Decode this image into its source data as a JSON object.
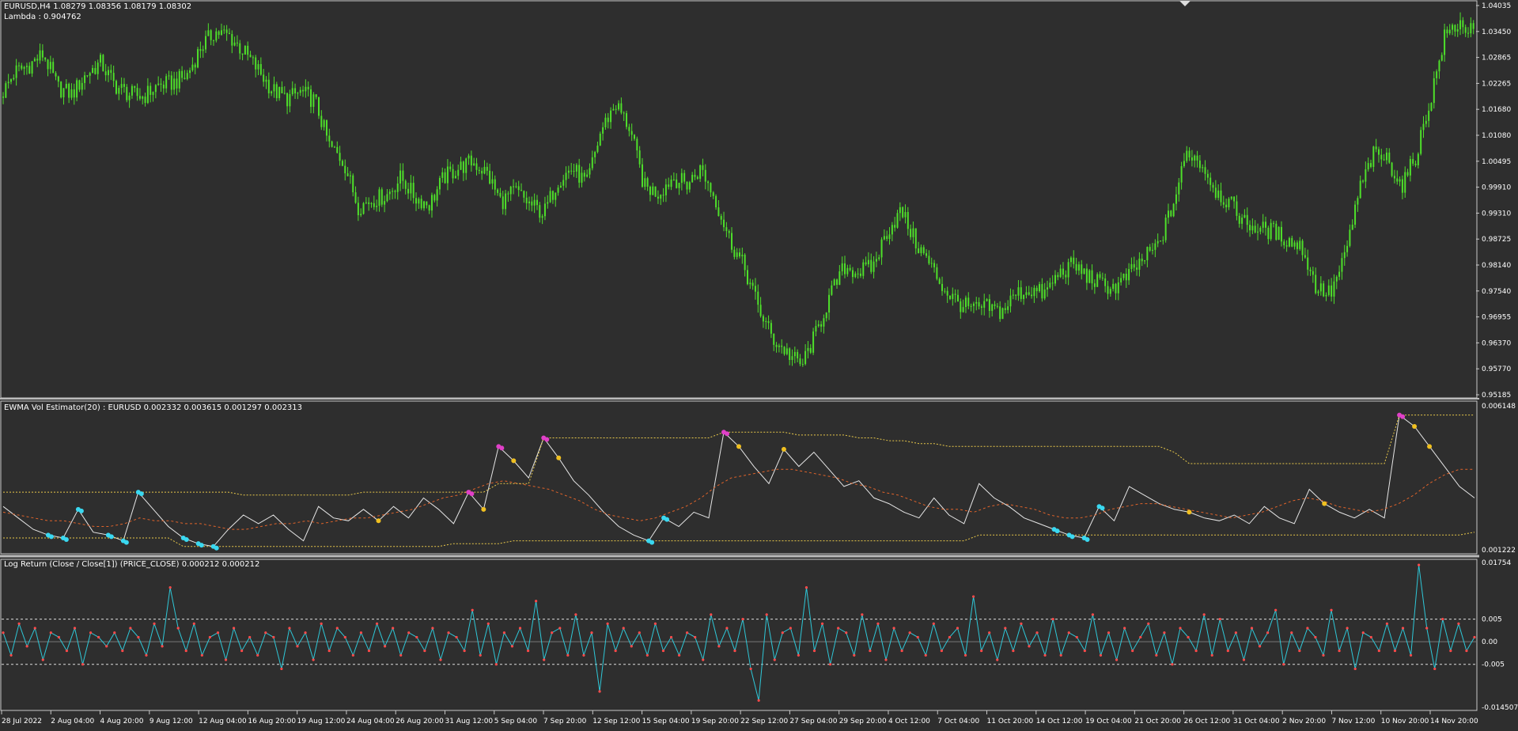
{
  "colors": {
    "background": "#2e2e2e",
    "frame": "#c8c8c8",
    "text": "#ffffff",
    "candle": "#4ee02a",
    "vol_line": "#e6e6e6",
    "vol_mean": "#e0632a",
    "band": "#e8c84a",
    "dot_low": "#3ad8f0",
    "dot_high": "#e040c8",
    "dot_mid": "#f0c020",
    "ret_line": "#2ec8d8",
    "ret_dot": "#ff4a4a",
    "ret_level": "#dddddd"
  },
  "price_panel": {
    "header": "EURUSD,H4  1.08279 1.08356 1.08179 1.08302",
    "subheader": "Lambda : 0.904762",
    "y_ticks": [
      "1.04035",
      "1.03450",
      "1.02865",
      "1.02265",
      "1.01680",
      "1.01080",
      "1.00495",
      "0.99910",
      "0.99310",
      "0.98725",
      "0.98140",
      "0.97540",
      "0.96955",
      "0.96370",
      "0.95770",
      "0.95185"
    ]
  },
  "vol_panel": {
    "header": "EWMA Vol Estimator(20) : EURUSD 0.002332 0.003615 0.001297 0.002313",
    "y_ticks": [
      "0.006148",
      "0.001222"
    ]
  },
  "ret_panel": {
    "header": "Log Return (Close / Close[1]) (PRICE_CLOSE) 0.000212 0.000212",
    "y_ticks": [
      "0.01754",
      "0.005",
      "0.00",
      "-0.005",
      "-0.014507"
    ]
  },
  "x_ticks": [
    "28 Jul 2022",
    "2 Aug 04:00",
    "4 Aug 20:00",
    "9 Aug 12:00",
    "12 Aug 04:00",
    "16 Aug 20:00",
    "19 Aug 12:00",
    "24 Aug 04:00",
    "26 Aug 20:00",
    "31 Aug 12:00",
    "5 Sep 04:00",
    "7 Sep 20:00",
    "12 Sep 12:00",
    "15 Sep 04:00",
    "19 Sep 20:00",
    "22 Sep 12:00",
    "27 Sep 04:00",
    "29 Sep 20:00",
    "4 Oct 12:00",
    "7 Oct 04:00",
    "11 Oct 20:00",
    "14 Oct 12:00",
    "19 Oct 04:00",
    "21 Oct 20:00",
    "26 Oct 12:00",
    "31 Oct 04:00",
    "2 Nov 20:00",
    "7 Nov 12:00",
    "10 Nov 20:00",
    "14 Nov 20:00"
  ],
  "chart_data": [
    {
      "type": "candlestick",
      "title": "EURUSD,H4",
      "ylim": [
        0.95185,
        1.04035
      ],
      "x_tick_labels": [
        "28 Jul 2022",
        "2 Aug 04:00",
        "4 Aug 20:00",
        "9 Aug 12:00",
        "12 Aug 04:00",
        "16 Aug 20:00",
        "19 Aug 12:00",
        "24 Aug 04:00",
        "26 Aug 20:00",
        "31 Aug 12:00",
        "5 Sep 04:00",
        "7 Sep 20:00",
        "12 Sep 12:00",
        "15 Sep 04:00",
        "19 Sep 20:00",
        "22 Sep 12:00",
        "27 Sep 04:00",
        "29 Sep 20:00",
        "4 Oct 12:00",
        "7 Oct 04:00",
        "11 Oct 20:00",
        "14 Oct 12:00",
        "19 Oct 04:00",
        "21 Oct 20:00",
        "26 Oct 12:00",
        "31 Oct 04:00",
        "2 Nov 20:00",
        "7 Nov 12:00",
        "10 Nov 20:00",
        "14 Nov 20:00"
      ],
      "close_path": [
        1.019,
        1.0245,
        1.026,
        1.0285,
        1.021,
        1.0195,
        1.024,
        1.0265,
        1.0215,
        1.0195,
        1.019,
        1.0215,
        1.022,
        1.0235,
        1.03,
        1.0335,
        1.0325,
        1.029,
        1.025,
        1.0205,
        1.0185,
        1.02,
        1.018,
        1.008,
        1.0045,
        0.9945,
        0.996,
        0.997,
        1.001,
        0.9965,
        0.995,
        1.001,
        1.003,
        1.0045,
        1.002,
        0.9955,
        0.998,
        0.995,
        0.993,
        1.0005,
        1.003,
        0.9995,
        1.0115,
        1.0175,
        1.012,
        0.999,
        0.9975,
        1.001,
        0.9995,
        1.003,
        0.996,
        0.987,
        0.981,
        0.972,
        0.965,
        0.962,
        0.959,
        0.966,
        0.9745,
        0.981,
        0.98,
        0.981,
        0.989,
        0.9935,
        0.9865,
        0.9815,
        0.976,
        0.973,
        0.9715,
        0.972,
        0.971,
        0.975,
        0.976,
        0.975,
        0.9795,
        0.9815,
        0.979,
        0.977,
        0.9765,
        0.9795,
        0.983,
        0.986,
        0.995,
        1.007,
        1.004,
        0.998,
        0.995,
        0.991,
        0.9895,
        0.989,
        0.987,
        0.9855,
        0.9765,
        0.975,
        0.983,
        0.998,
        1.006,
        1.005,
        0.999,
        1.006,
        1.0185,
        1.0325,
        1.0355,
        1.033
      ],
      "last": {
        "open": 1.08279,
        "high": 1.08356,
        "low": 1.08179,
        "close": 1.08302
      }
    },
    {
      "type": "line",
      "title": "EWMA Vol Estimator(20) : EURUSD",
      "ylim": [
        0.001222,
        0.006148
      ],
      "series": [
        {
          "values": [
            0.0026,
            0.0022,
            0.0018,
            0.0016,
            0.0015,
            0.0025,
            0.0017,
            0.0016,
            0.0014,
            0.0031,
            0.0025,
            0.0019,
            0.0015,
            0.0013,
            0.0012,
            0.0018,
            0.0023,
            0.002,
            0.0023,
            0.0018,
            0.0014,
            0.0026,
            0.0022,
            0.0021,
            0.0025,
            0.0021,
            0.0026,
            0.0022,
            0.0029,
            0.0025,
            0.002,
            0.0031,
            0.0025,
            0.0047,
            0.0042,
            0.0036,
            0.005,
            0.0043,
            0.0035,
            0.003,
            0.0024,
            0.0019,
            0.0016,
            0.0014,
            0.0022,
            0.0019,
            0.0024,
            0.0022,
            0.0052,
            0.0047,
            0.004,
            0.0034,
            0.0046,
            0.004,
            0.0045,
            0.0039,
            0.0033,
            0.0035,
            0.0029,
            0.0027,
            0.0024,
            0.0022,
            0.0029,
            0.0023,
            0.002,
            0.0034,
            0.0029,
            0.0026,
            0.0022,
            0.002,
            0.0018,
            0.0016,
            0.0015,
            0.0026,
            0.0021,
            0.0033,
            0.003,
            0.0027,
            0.0025,
            0.0024,
            0.0022,
            0.0021,
            0.0023,
            0.002,
            0.0026,
            0.0022,
            0.002,
            0.0032,
            0.0027,
            0.0024,
            0.0022,
            0.0025,
            0.0022,
            0.0058,
            0.0054,
            0.0047,
            0.004,
            0.0033,
            0.0029
          ]
        },
        {
          "values": [
            0.0024,
            0.0023,
            0.0022,
            0.0021,
            0.0021,
            0.002,
            0.0019,
            0.0019,
            0.002,
            0.0022,
            0.0021,
            0.0021,
            0.002,
            0.002,
            0.0019,
            0.0018,
            0.0018,
            0.0019,
            0.002,
            0.002,
            0.0021,
            0.002,
            0.0021,
            0.0022,
            0.0022,
            0.0023,
            0.0024,
            0.0025,
            0.0027,
            0.0029,
            0.003,
            0.0032,
            0.0034,
            0.0035,
            0.0034,
            0.0033,
            0.0032,
            0.003,
            0.0028,
            0.0025,
            0.0023,
            0.0022,
            0.0021,
            0.0022,
            0.0024,
            0.0026,
            0.0029,
            0.0033,
            0.0036,
            0.0037,
            0.0038,
            0.0039,
            0.0039,
            0.0038,
            0.0037,
            0.0036,
            0.0034,
            0.0033,
            0.0031,
            0.003,
            0.0028,
            0.0026,
            0.0025,
            0.0025,
            0.0024,
            0.0026,
            0.0027,
            0.0026,
            0.0025,
            0.0023,
            0.0022,
            0.0022,
            0.0023,
            0.0025,
            0.0026,
            0.0027,
            0.0027,
            0.0026,
            0.0025,
            0.0024,
            0.0023,
            0.0022,
            0.0023,
            0.0024,
            0.0026,
            0.0028,
            0.0029,
            0.0028,
            0.0026,
            0.0025,
            0.0024,
            0.0025,
            0.0027,
            0.003,
            0.0034,
            0.0037,
            0.0039,
            0.0039
          ]
        },
        {
          "values": [
            0.0031,
            0.0031,
            0.0031,
            0.0031,
            0.0031,
            0.0031,
            0.0031,
            0.0031,
            0.0031,
            0.0031,
            0.0031,
            0.0031,
            0.0031,
            0.0031,
            0.0031,
            0.0031,
            0.003,
            0.003,
            0.003,
            0.003,
            0.003,
            0.003,
            0.003,
            0.003,
            0.0031,
            0.0031,
            0.0031,
            0.0031,
            0.0031,
            0.0031,
            0.0031,
            0.0031,
            0.0031,
            0.0034,
            0.0034,
            0.0034,
            0.005,
            0.005,
            0.005,
            0.005,
            0.005,
            0.005,
            0.005,
            0.005,
            0.005,
            0.005,
            0.005,
            0.005,
            0.0052,
            0.0052,
            0.0052,
            0.0052,
            0.0052,
            0.0051,
            0.0051,
            0.0051,
            0.0051,
            0.005,
            0.005,
            0.0049,
            0.0049,
            0.0048,
            0.0048,
            0.0047,
            0.0047,
            0.0047,
            0.0047,
            0.0047,
            0.0047,
            0.0047,
            0.0047,
            0.0047,
            0.0047,
            0.0047,
            0.0047,
            0.0047,
            0.0047,
            0.0047,
            0.0045,
            0.0041,
            0.0041,
            0.0041,
            0.0041,
            0.0041,
            0.0041,
            0.0041,
            0.0041,
            0.0041,
            0.0041,
            0.0041,
            0.0041,
            0.0041,
            0.0041,
            0.0058,
            0.0058,
            0.0058,
            0.0058,
            0.0058,
            0.0058
          ]
        },
        {
          "values": [
            0.0015,
            0.0015,
            0.0015,
            0.0015,
            0.0015,
            0.0015,
            0.0015,
            0.0015,
            0.0015,
            0.0015,
            0.0015,
            0.0015,
            0.0012,
            0.0012,
            0.0012,
            0.0012,
            0.0012,
            0.0012,
            0.0012,
            0.0012,
            0.0012,
            0.0012,
            0.0012,
            0.0012,
            0.0012,
            0.0012,
            0.0012,
            0.0012,
            0.0012,
            0.0012,
            0.0013,
            0.0013,
            0.0013,
            0.0013,
            0.0014,
            0.0014,
            0.0014,
            0.0014,
            0.0014,
            0.0014,
            0.0014,
            0.0014,
            0.0014,
            0.0014,
            0.0014,
            0.0014,
            0.0014,
            0.0014,
            0.0014,
            0.0014,
            0.0014,
            0.0014,
            0.0014,
            0.0014,
            0.0014,
            0.0014,
            0.0014,
            0.0014,
            0.0014,
            0.0014,
            0.0014,
            0.0014,
            0.0014,
            0.0014,
            0.0014,
            0.0016,
            0.0016,
            0.0016,
            0.0016,
            0.0016,
            0.0016,
            0.0016,
            0.0016,
            0.0016,
            0.0016,
            0.0016,
            0.0016,
            0.0016,
            0.0016,
            0.0016,
            0.0016,
            0.0016,
            0.0016,
            0.0016,
            0.0016,
            0.0016,
            0.0016,
            0.0016,
            0.0016,
            0.0016,
            0.0016,
            0.0016,
            0.0016,
            0.0016,
            0.0016,
            0.0016,
            0.0016,
            0.0016,
            0.0017
          ]
        }
      ],
      "markers": {
        "low_cyan_idx": [
          3,
          4,
          5,
          7,
          8,
          9,
          12,
          13,
          14,
          43,
          44,
          70,
          71,
          72,
          73
        ],
        "high_magenta_idx": [
          31,
          33,
          36,
          48,
          93
        ],
        "mid_yellow_idx": [
          25,
          32,
          34,
          37,
          49,
          52,
          79,
          88,
          94,
          95
        ]
      }
    },
    {
      "type": "line",
      "title": "Log Return (Close / Close[1]) (PRICE_CLOSE)",
      "ylim": [
        -0.014507,
        0.01754
      ],
      "levels": [
        0.005,
        0.0,
        -0.005
      ],
      "values": [
        0.002,
        -0.003,
        0.004,
        -0.001,
        0.003,
        -0.004,
        0.002,
        0.001,
        -0.002,
        0.003,
        -0.005,
        0.002,
        0.001,
        -0.001,
        0.002,
        -0.002,
        0.003,
        0.001,
        -0.003,
        0.004,
        -0.001,
        0.012,
        0.003,
        -0.002,
        0.004,
        -0.003,
        0.001,
        0.002,
        -0.004,
        0.003,
        -0.002,
        0.001,
        -0.003,
        0.002,
        0.001,
        -0.006,
        0.003,
        -0.001,
        0.002,
        -0.004,
        0.004,
        -0.002,
        0.003,
        0.001,
        -0.003,
        0.002,
        -0.002,
        0.004,
        -0.001,
        0.003,
        -0.003,
        0.002,
        0.001,
        -0.002,
        0.003,
        -0.004,
        0.002,
        0.001,
        -0.002,
        0.007,
        -0.003,
        0.004,
        -0.005,
        0.002,
        -0.001,
        0.003,
        -0.002,
        0.009,
        -0.004,
        0.002,
        0.003,
        -0.003,
        0.006,
        -0.003,
        0.002,
        -0.011,
        0.004,
        -0.002,
        0.003,
        -0.001,
        0.002,
        -0.003,
        0.004,
        -0.002,
        0.001,
        -0.003,
        0.002,
        0.001,
        -0.004,
        0.006,
        -0.001,
        0.003,
        -0.002,
        0.005,
        -0.006,
        -0.013,
        0.006,
        -0.004,
        0.002,
        0.003,
        -0.003,
        0.012,
        -0.002,
        0.004,
        -0.005,
        0.003,
        0.002,
        -0.003,
        0.006,
        -0.002,
        0.004,
        -0.004,
        0.003,
        -0.002,
        0.002,
        0.001,
        -0.003,
        0.004,
        -0.002,
        0.001,
        0.003,
        -0.003,
        0.01,
        -0.002,
        0.002,
        -0.004,
        0.003,
        -0.002,
        0.004,
        -0.001,
        0.002,
        -0.003,
        0.005,
        -0.003,
        0.002,
        0.001,
        -0.002,
        0.006,
        -0.003,
        0.002,
        -0.004,
        0.003,
        -0.002,
        0.001,
        0.004,
        -0.003,
        0.002,
        -0.005,
        0.003,
        0.001,
        -0.002,
        0.006,
        -0.003,
        0.005,
        -0.002,
        0.002,
        -0.004,
        0.003,
        -0.001,
        0.002,
        0.007,
        -0.005,
        0.002,
        -0.002,
        0.003,
        0.001,
        -0.003,
        0.007,
        -0.002,
        0.003,
        -0.006,
        0.002,
        0.001,
        -0.002,
        0.004,
        -0.002,
        0.003,
        -0.003,
        0.017,
        0.003,
        -0.006,
        0.005,
        -0.002,
        0.004,
        -0.002,
        0.001
      ]
    }
  ]
}
